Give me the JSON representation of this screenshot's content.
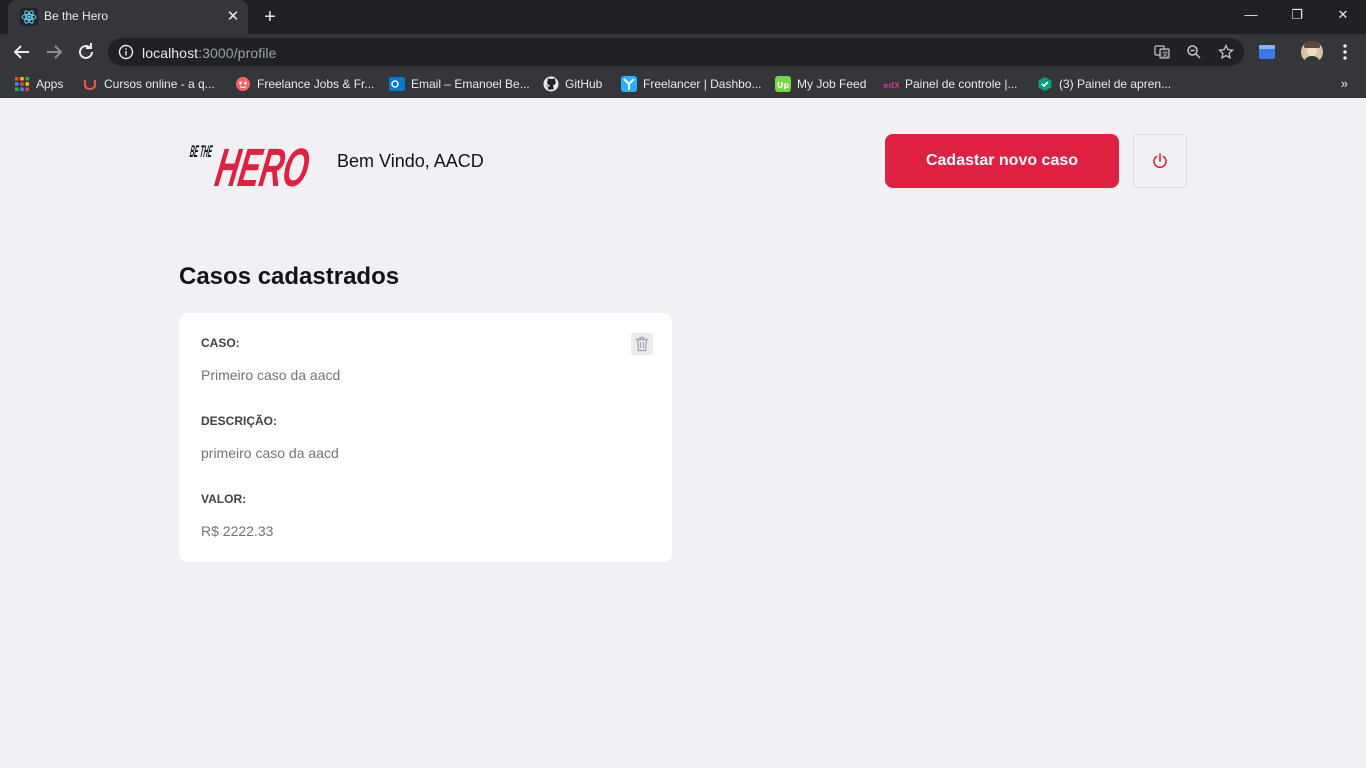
{
  "browser": {
    "tab": {
      "title": "Be the Hero",
      "close_label": "✕"
    },
    "new_tab_label": "+",
    "window_controls": {
      "minimize": "—",
      "restore": "❐",
      "close": "✕"
    },
    "address": {
      "host": "localhost",
      "path": ":3000/profile"
    },
    "bookmarks": [
      {
        "label": "Apps",
        "icon": "apps-grid-icon",
        "color": "#e8eaed"
      },
      {
        "label": "Cursos online - a q...",
        "icon": "udemy-icon",
        "color": "#ec5252"
      },
      {
        "label": "Freelance Jobs & Fr...",
        "icon": "workana-icon",
        "color": "#ff5f5f"
      },
      {
        "label": "Email – Emanoel Be...",
        "icon": "outlook-icon",
        "color": "#0078d4"
      },
      {
        "label": "GitHub",
        "icon": "github-icon",
        "color": "#e8eaed"
      },
      {
        "label": "Freelancer | Dashbo...",
        "icon": "freelancer-icon",
        "color": "#29b2fe"
      },
      {
        "label": "My Job Feed",
        "icon": "upwork-icon",
        "color": "#6fda44"
      },
      {
        "label": "Painel de controle |...",
        "icon": "edx-icon",
        "color": "#c0378a"
      },
      {
        "label": "(3) Painel de apren...",
        "icon": "alura-icon",
        "color": "#05a081"
      }
    ],
    "bookmarks_more": "»"
  },
  "header": {
    "logo_text_small": "BE THE",
    "logo_text_big": "HERO",
    "welcome": "Bem Vindo, AACD",
    "new_case_button": "Cadastar novo caso"
  },
  "main": {
    "section_title": "Casos cadastrados",
    "cases": [
      {
        "case_label": "CASO:",
        "case_value": "Primeiro caso da aacd",
        "description_label": "DESCRIÇÃO:",
        "description_value": "primeiro caso da aacd",
        "value_label": "VALOR:",
        "value_value": "R$ 2222.33"
      }
    ]
  },
  "colors": {
    "brand_red": "#e02041",
    "page_background": "#f0f0f5",
    "chrome_dark": "#202124",
    "chrome_toolbar": "#35363a"
  }
}
